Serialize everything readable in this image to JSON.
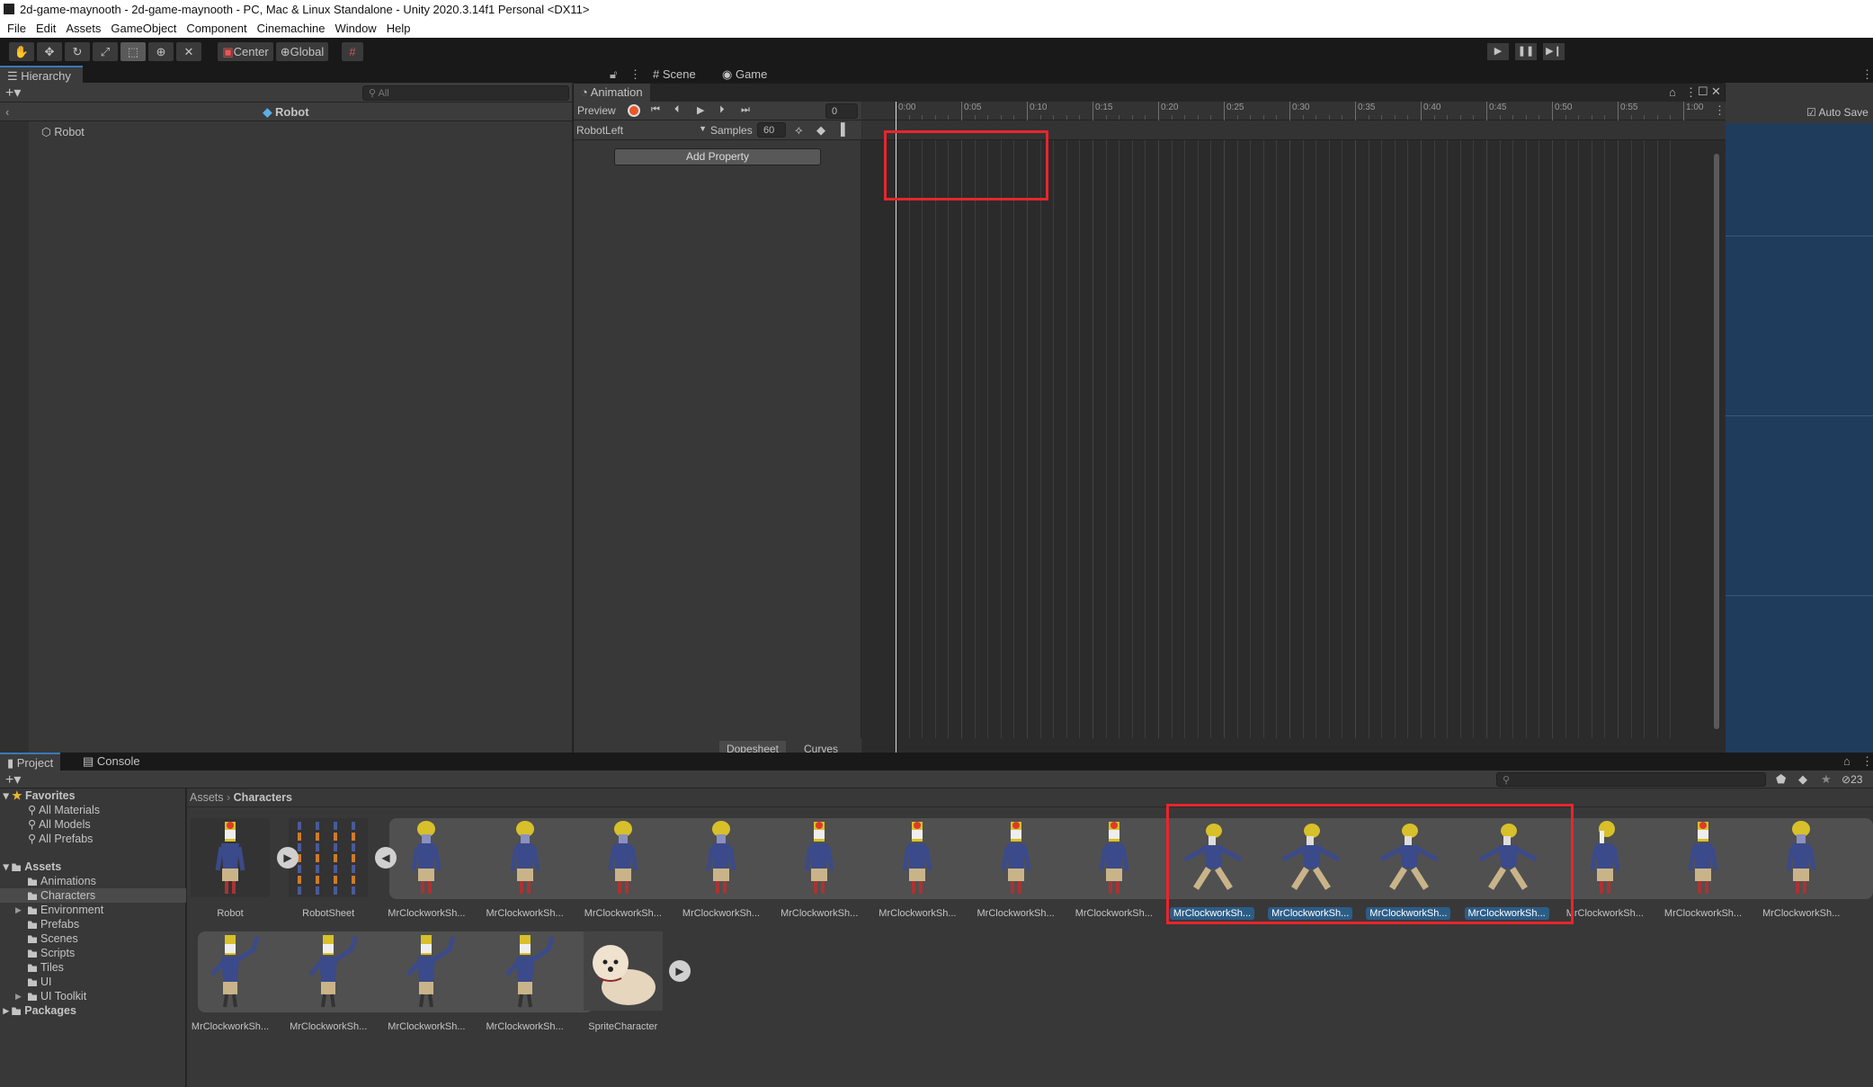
{
  "window": {
    "title": "2d-game-maynooth - 2d-game-maynooth - PC, Mac & Linux Standalone - Unity 2020.3.14f1 Personal <DX11>"
  },
  "menu": [
    "File",
    "Edit",
    "Assets",
    "GameObject",
    "Component",
    "Cinemachine",
    "Window",
    "Help"
  ],
  "toolbar": {
    "tools": [
      "hand-tool",
      "move-tool",
      "rotate-tool",
      "scale-tool",
      "rect-tool",
      "transform-tool",
      "custom-tool"
    ],
    "active_tool": "rect-tool",
    "pivot": "Center",
    "space": "Global"
  },
  "hierarchy": {
    "tab": "Hierarchy",
    "search_placeholder": "All",
    "header": "Robot",
    "items": [
      "Robot"
    ]
  },
  "scene_tabs": [
    "Scene",
    "Game"
  ],
  "scene": {
    "auto_save": "Auto Save",
    "auto_save_checked": true,
    "bg_color": "#1f3c5c"
  },
  "animation": {
    "tab": "Animation",
    "preview": "Preview",
    "frame": "0",
    "clip": "RobotLeft",
    "samples_label": "Samples",
    "samples": "60",
    "add_property": "Add Property",
    "ruler": [
      "0:00",
      "0:05",
      "0:10",
      "0:15",
      "0:20",
      "0:25",
      "0:30",
      "0:35",
      "0:40",
      "0:45",
      "0:50",
      "0:55",
      "1:00"
    ],
    "bottom_tabs": [
      "Dopesheet",
      "Curves"
    ],
    "active_bottom_tab": "Dopesheet"
  },
  "project": {
    "tabs": [
      "Project",
      "Console"
    ],
    "hidden_count": "23",
    "favorites": {
      "label": "Favorites",
      "items": [
        "All Materials",
        "All Models",
        "All Prefabs"
      ]
    },
    "assets": {
      "label": "Assets",
      "folders": [
        "Animations",
        "Characters",
        "Environment",
        "Prefabs",
        "Scenes",
        "Scripts",
        "Tiles",
        "UI",
        "UI Toolkit"
      ]
    },
    "selected_folder": "Characters",
    "packages": "Packages",
    "breadcrumb": [
      "Assets",
      "Characters"
    ],
    "row1": [
      {
        "name": "Robot",
        "kind": "robot"
      },
      {
        "name": "RobotSheet",
        "kind": "sheet"
      },
      {
        "name": "MrClockworkSh...",
        "kind": "back"
      },
      {
        "name": "MrClockworkSh...",
        "kind": "back"
      },
      {
        "name": "MrClockworkSh...",
        "kind": "back"
      },
      {
        "name": "MrClockworkSh...",
        "kind": "back"
      },
      {
        "name": "MrClockworkSh...",
        "kind": "front"
      },
      {
        "name": "MrClockworkSh...",
        "kind": "front"
      },
      {
        "name": "MrClockworkSh...",
        "kind": "front"
      },
      {
        "name": "MrClockworkSh...",
        "kind": "front"
      },
      {
        "name": "MrClockworkSh...",
        "kind": "walk",
        "selected": true
      },
      {
        "name": "MrClockworkSh...",
        "kind": "walk",
        "selected": true
      },
      {
        "name": "MrClockworkSh...",
        "kind": "walk",
        "selected": true
      },
      {
        "name": "MrClockworkSh...",
        "kind": "walk",
        "selected": true
      },
      {
        "name": "MrClockworkSh...",
        "kind": "side"
      },
      {
        "name": "MrClockworkSh...",
        "kind": "front"
      },
      {
        "name": "MrClockworkSh...",
        "kind": "back"
      }
    ],
    "row2": [
      {
        "name": "MrClockworkSh...",
        "kind": "wave"
      },
      {
        "name": "MrClockworkSh...",
        "kind": "wave"
      },
      {
        "name": "MrClockworkSh...",
        "kind": "wave"
      },
      {
        "name": "MrClockworkSh...",
        "kind": "wave"
      },
      {
        "name": "SpriteCharacter",
        "kind": "dog"
      }
    ]
  }
}
